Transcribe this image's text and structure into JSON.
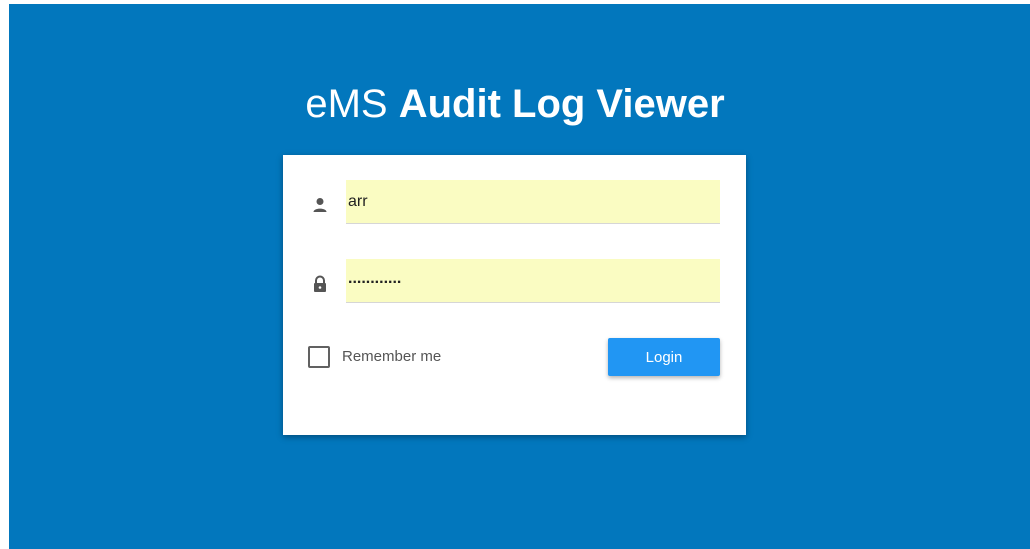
{
  "app": {
    "title_light": "eMS",
    "title_bold": "Audit Log Viewer"
  },
  "colors": {
    "background": "#0277bd",
    "card": "#ffffff",
    "autofill": "#fafcc2",
    "login_button": "#2196f3"
  },
  "login_form": {
    "username_icon": "person-icon",
    "username_value": "arr",
    "password_icon": "lock-icon",
    "password_value": "............",
    "remember_checked": false,
    "remember_label": "Remember me",
    "login_label": "Login"
  }
}
